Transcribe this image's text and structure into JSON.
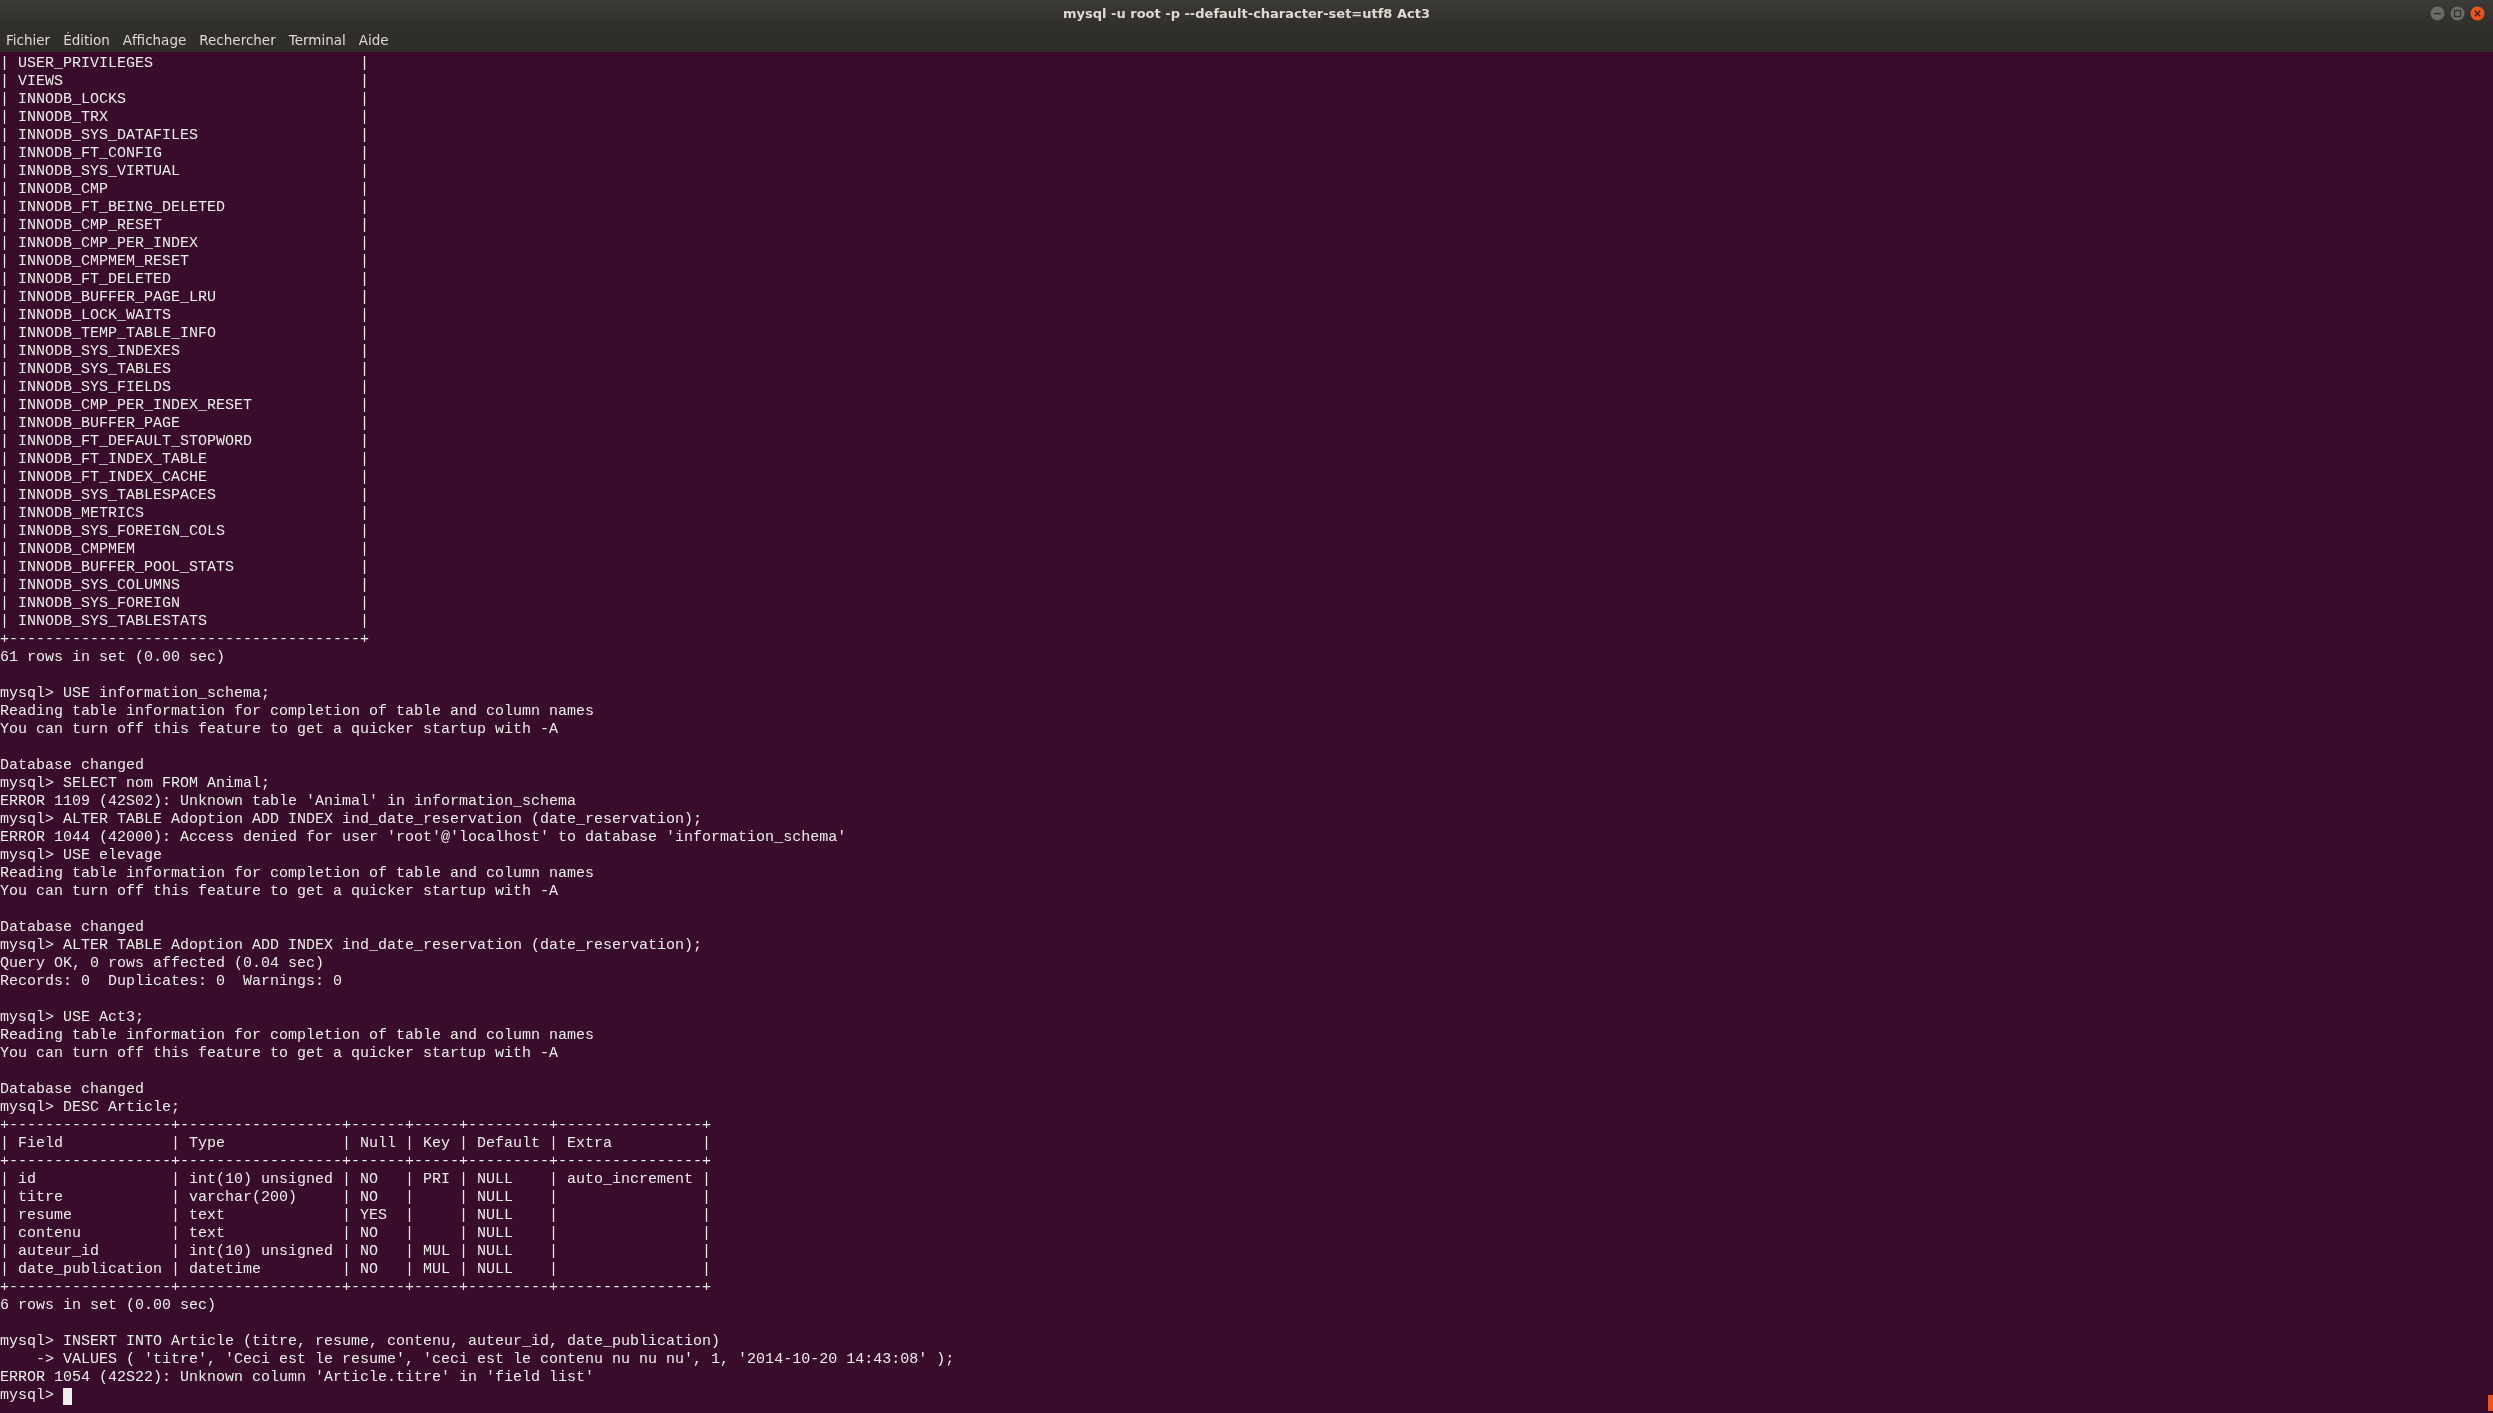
{
  "window": {
    "title": "mysql -u root -p --default-character-set=utf8 Act3"
  },
  "menu": [
    "Fichier",
    "Édition",
    "Affichage",
    "Rechercher",
    "Terminal",
    "Aide"
  ],
  "terminal": {
    "cursor_visible": true,
    "blocks": [
      [
        "| USER_PRIVILEGES                       |",
        "| VIEWS                                 |",
        "| INNODB_LOCKS                          |",
        "| INNODB_TRX                            |",
        "| INNODB_SYS_DATAFILES                  |",
        "| INNODB_FT_CONFIG                      |",
        "| INNODB_SYS_VIRTUAL                    |",
        "| INNODB_CMP                            |",
        "| INNODB_FT_BEING_DELETED               |",
        "| INNODB_CMP_RESET                      |",
        "| INNODB_CMP_PER_INDEX                  |",
        "| INNODB_CMPMEM_RESET                   |",
        "| INNODB_FT_DELETED                     |",
        "| INNODB_BUFFER_PAGE_LRU                |",
        "| INNODB_LOCK_WAITS                     |",
        "| INNODB_TEMP_TABLE_INFO                |",
        "| INNODB_SYS_INDEXES                    |",
        "| INNODB_SYS_TABLES                     |",
        "| INNODB_SYS_FIELDS                     |",
        "| INNODB_CMP_PER_INDEX_RESET            |",
        "| INNODB_BUFFER_PAGE                    |",
        "| INNODB_FT_DEFAULT_STOPWORD            |",
        "| INNODB_FT_INDEX_TABLE                 |",
        "| INNODB_FT_INDEX_CACHE                 |",
        "| INNODB_SYS_TABLESPACES                |",
        "| INNODB_METRICS                        |",
        "| INNODB_SYS_FOREIGN_COLS               |",
        "| INNODB_CMPMEM                         |",
        "| INNODB_BUFFER_POOL_STATS              |",
        "| INNODB_SYS_COLUMNS                    |",
        "| INNODB_SYS_FOREIGN                    |",
        "| INNODB_SYS_TABLESTATS                 |",
        "+---------------------------------------+",
        "61 rows in set (0.00 sec)"
      ],
      [
        "mysql> USE information_schema;",
        "Reading table information for completion of table and column names",
        "You can turn off this feature to get a quicker startup with -A"
      ],
      [
        "Database changed",
        "mysql> SELECT nom FROM Animal;",
        "ERROR 1109 (42S02): Unknown table 'Animal' in information_schema",
        "mysql> ALTER TABLE Adoption ADD INDEX ind_date_reservation (date_reservation);",
        "ERROR 1044 (42000): Access denied for user 'root'@'localhost' to database 'information_schema'",
        "mysql> USE elevage",
        "Reading table information for completion of table and column names",
        "You can turn off this feature to get a quicker startup with -A"
      ],
      [
        "Database changed",
        "mysql> ALTER TABLE Adoption ADD INDEX ind_date_reservation (date_reservation);",
        "Query OK, 0 rows affected (0.04 sec)",
        "Records: 0  Duplicates: 0  Warnings: 0"
      ],
      [
        "mysql> USE Act3;",
        "Reading table information for completion of table and column names",
        "You can turn off this feature to get a quicker startup with -A"
      ],
      [
        "Database changed",
        "mysql> DESC Article;",
        "+------------------+------------------+------+-----+---------+----------------+",
        "| Field            | Type             | Null | Key | Default | Extra          |",
        "+------------------+------------------+------+-----+---------+----------------+",
        "| id               | int(10) unsigned | NO   | PRI | NULL    | auto_increment |",
        "| titre            | varchar(200)     | NO   |     | NULL    |                |",
        "| resume           | text             | YES  |     | NULL    |                |",
        "| contenu          | text             | NO   |     | NULL    |                |",
        "| auteur_id        | int(10) unsigned | NO   | MUL | NULL    |                |",
        "| date_publication | datetime         | NO   | MUL | NULL    |                |",
        "+------------------+------------------+------+-----+---------+----------------+",
        "6 rows in set (0.00 sec)"
      ],
      [
        "mysql> INSERT INTO Article (titre, resume, contenu, auteur_id, date_publication)",
        "    -> VALUES ( 'titre', 'Ceci est le resume', 'ceci est le contenu nu nu nu', 1, '2014-10-20 14:43:08' );",
        "ERROR 1054 (42S22): Unknown column 'Article.titre' in 'field list'",
        "mysql>"
      ]
    ]
  }
}
